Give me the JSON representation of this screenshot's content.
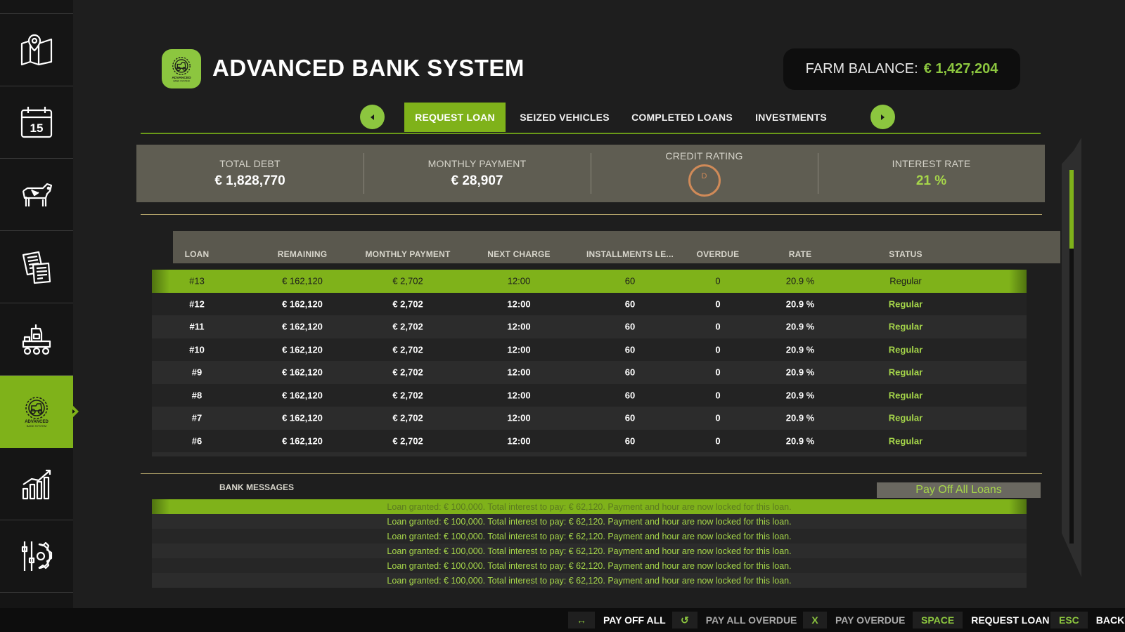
{
  "app": {
    "title": "ADVANCED BANK SYSTEM",
    "logo_text": "ADVANCED BANK SYSTEM",
    "balance_label": "FARM BALANCE:",
    "balance_value": "€ 1,427,204",
    "accent_color": "#7fb21a",
    "highlight_color": "#a6d64a"
  },
  "sidebar": {
    "items": [
      {
        "icon": "map-icon",
        "active": false
      },
      {
        "icon": "calendar-icon",
        "label": "15",
        "active": false
      },
      {
        "icon": "cow-icon",
        "active": false
      },
      {
        "icon": "contracts-icon",
        "active": false
      },
      {
        "icon": "production-icon",
        "active": false
      },
      {
        "icon": "bank-icon",
        "active": true
      },
      {
        "icon": "statistics-icon",
        "active": false
      },
      {
        "icon": "settings-icon",
        "active": false
      }
    ]
  },
  "tabs": {
    "items": [
      {
        "label": "REQUEST LOAN",
        "active": true
      },
      {
        "label": "SEIZED VEHICLES",
        "active": false
      },
      {
        "label": "COMPLETED LOANS",
        "active": false
      },
      {
        "label": "INVESTMENTS",
        "active": false
      }
    ]
  },
  "stats": {
    "total_debt_label": "TOTAL DEBT",
    "total_debt_value": "€ 1,828,770",
    "monthly_payment_label": "MONTHLY PAYMENT",
    "monthly_payment_value": "€ 28,907",
    "credit_rating_label": "CREDIT RATING",
    "credit_rating_value": "D",
    "interest_rate_label": "INTEREST RATE",
    "interest_rate_value": "21 %"
  },
  "table": {
    "headers": [
      "LOAN",
      "REMAINING",
      "MONTHLY PAYMENT",
      "NEXT CHARGE",
      "INSTALLMENTS LE...",
      "OVERDUE",
      "RATE",
      "STATUS"
    ],
    "rows": [
      [
        "#13",
        "€ 162,120",
        "€ 2,702",
        "12:00",
        "60",
        "0",
        "20.9 %",
        "Regular"
      ],
      [
        "#12",
        "€ 162,120",
        "€ 2,702",
        "12:00",
        "60",
        "0",
        "20.9 %",
        "Regular"
      ],
      [
        "#11",
        "€ 162,120",
        "€ 2,702",
        "12:00",
        "60",
        "0",
        "20.9 %",
        "Regular"
      ],
      [
        "#10",
        "€ 162,120",
        "€ 2,702",
        "12:00",
        "60",
        "0",
        "20.9 %",
        "Regular"
      ],
      [
        "#9",
        "€ 162,120",
        "€ 2,702",
        "12:00",
        "60",
        "0",
        "20.9 %",
        "Regular"
      ],
      [
        "#8",
        "€ 162,120",
        "€ 2,702",
        "12:00",
        "60",
        "0",
        "20.9 %",
        "Regular"
      ],
      [
        "#7",
        "€ 162,120",
        "€ 2,702",
        "12:00",
        "60",
        "0",
        "20.9 %",
        "Regular"
      ],
      [
        "#6",
        "€ 162,120",
        "€ 2,702",
        "12:00",
        "60",
        "0",
        "20.9 %",
        "Regular"
      ]
    ],
    "selected_row": 0
  },
  "messages": {
    "title": "BANK MESSAGES",
    "pay_off_all_label": "Pay Off All Loans",
    "items": [
      "Loan granted: € 100,000. Total interest to pay: € 62,120. Payment and hour are now locked for this loan.",
      "Loan granted: € 100,000. Total interest to pay: € 62,120. Payment and hour are now locked for this loan.",
      "Loan granted: € 100,000. Total interest to pay: € 62,120. Payment and hour are now locked for this loan.",
      "Loan granted: € 100,000. Total interest to pay: € 62,120. Payment and hour are now locked for this loan.",
      "Loan granted: € 100,000. Total interest to pay: € 62,120. Payment and hour are now locked for this loan.",
      "Loan granted: € 100,000. Total interest to pay: € 62,120. Payment and hour are now locked for this loan."
    ],
    "selected_index": 0
  },
  "footer": {
    "hints": [
      {
        "key": "↔",
        "label": "PAY OFF ALL",
        "dim": false
      },
      {
        "key": "↺",
        "label": "PAY ALL OVERDUE",
        "dim": true
      },
      {
        "key": "X",
        "label": "PAY OVERDUE",
        "dim": true
      },
      {
        "key": "SPACE",
        "label": "REQUEST LOAN",
        "dim": false
      },
      {
        "key": "ESC",
        "label": "BACK",
        "dim": false
      }
    ]
  }
}
